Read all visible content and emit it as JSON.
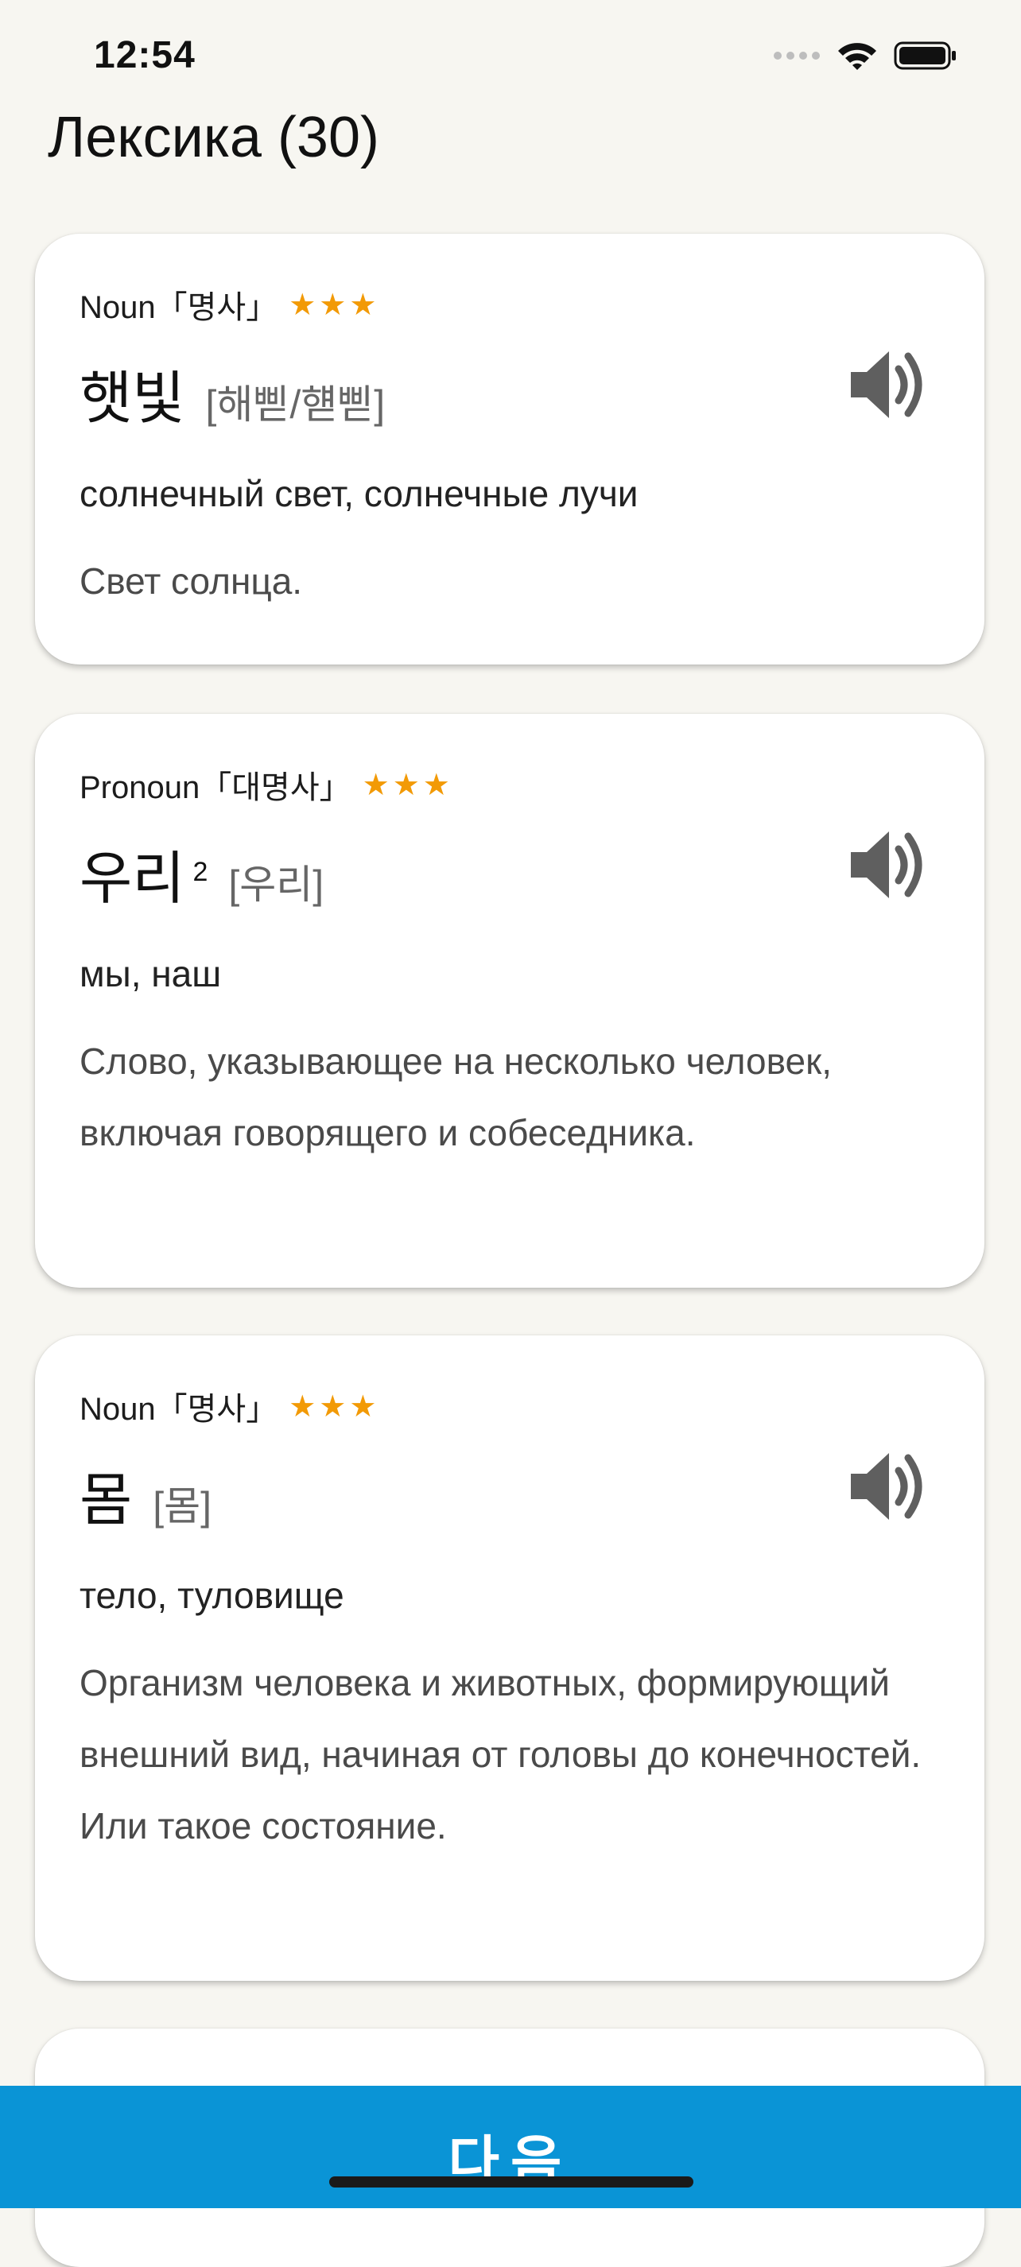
{
  "status": {
    "time": "12:54"
  },
  "header": {
    "title": "Лексика (30)"
  },
  "cards": [
    {
      "pos": "Noun「명사」",
      "stars": "★★★",
      "word": "햇빛",
      "superscript": "",
      "pronunciation": "[해삗/햳삗]",
      "meaning": "солнечный свет, солнечные лучи",
      "definition": "Свет солнца."
    },
    {
      "pos": "Pronoun「대명사」",
      "stars": "★★★",
      "word": "우리",
      "superscript": "2",
      "pronunciation": "[우리]",
      "meaning": "мы, наш",
      "definition": "Слово, указывающее на несколько человек, включая говорящего и собеседника."
    },
    {
      "pos": "Noun「명사」",
      "stars": "★★★",
      "word": "몸",
      "superscript": "",
      "pronunciation": "[몸]",
      "meaning": "тело, туловище",
      "definition": "Организм человека и животных, формирующий внешний вид, начиная от головы до конечностей. Или такое состояние."
    }
  ],
  "footer": {
    "next_label": "다음"
  },
  "colors": {
    "accent": "#0a94d6",
    "star": "#f29a06",
    "background": "#f7f6f1"
  },
  "icons": {
    "speaker": "speaker-icon",
    "wifi": "wifi-icon",
    "battery": "battery-icon",
    "cellular": "cellular-icon"
  }
}
